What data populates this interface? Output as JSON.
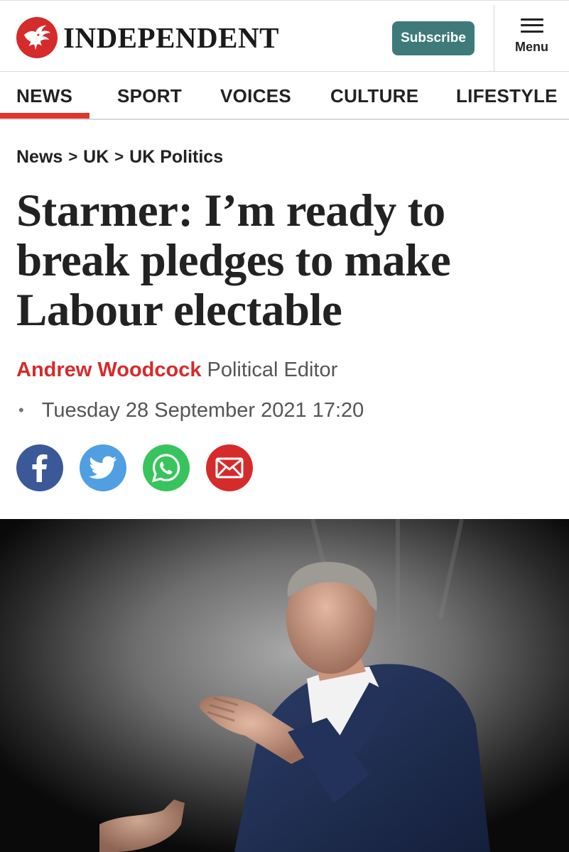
{
  "header": {
    "brand_name": "INDEPENDENT",
    "logo_icon": "eagle-icon",
    "subscribe_label": "Subscribe",
    "menu_label": "Menu",
    "menu_icon": "hamburger-icon",
    "brand_red": "#d52b2b",
    "subscribe_color": "#3e7a7a"
  },
  "nav": {
    "items": [
      {
        "label": "NEWS",
        "active": true
      },
      {
        "label": "SPORT",
        "active": false
      },
      {
        "label": "VOICES",
        "active": false
      },
      {
        "label": "CULTURE",
        "active": false
      },
      {
        "label": "LIFESTYLE",
        "active": false
      }
    ],
    "active_color": "#e1352c"
  },
  "article": {
    "breadcrumb": [
      "News",
      "UK",
      "UK Politics"
    ],
    "breadcrumb_separator": ">",
    "headline": "Starmer: I’m ready to break pledges to make Labour electable",
    "author": "Andrew Woodcock",
    "author_role": "Political Editor",
    "date_bullet": "•",
    "date": "Tuesday 28 September 2021 17:20",
    "share": [
      {
        "network": "Facebook",
        "icon": "facebook-icon",
        "color": "#3b5998"
      },
      {
        "network": "Twitter",
        "icon": "twitter-icon",
        "color": "#4f9fe2"
      },
      {
        "network": "WhatsApp",
        "icon": "whatsapp-icon",
        "color": "#38c45c"
      },
      {
        "network": "Email",
        "icon": "email-icon",
        "color": "#d52b2b"
      }
    ]
  }
}
